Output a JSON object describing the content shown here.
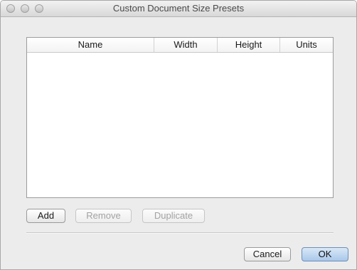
{
  "window": {
    "title": "Custom Document Size Presets"
  },
  "table": {
    "columns": [
      "Name",
      "Width",
      "Height",
      "Units"
    ],
    "rows": []
  },
  "buttons": {
    "add": "Add",
    "remove": "Remove",
    "duplicate": "Duplicate",
    "cancel": "Cancel",
    "ok": "OK"
  }
}
